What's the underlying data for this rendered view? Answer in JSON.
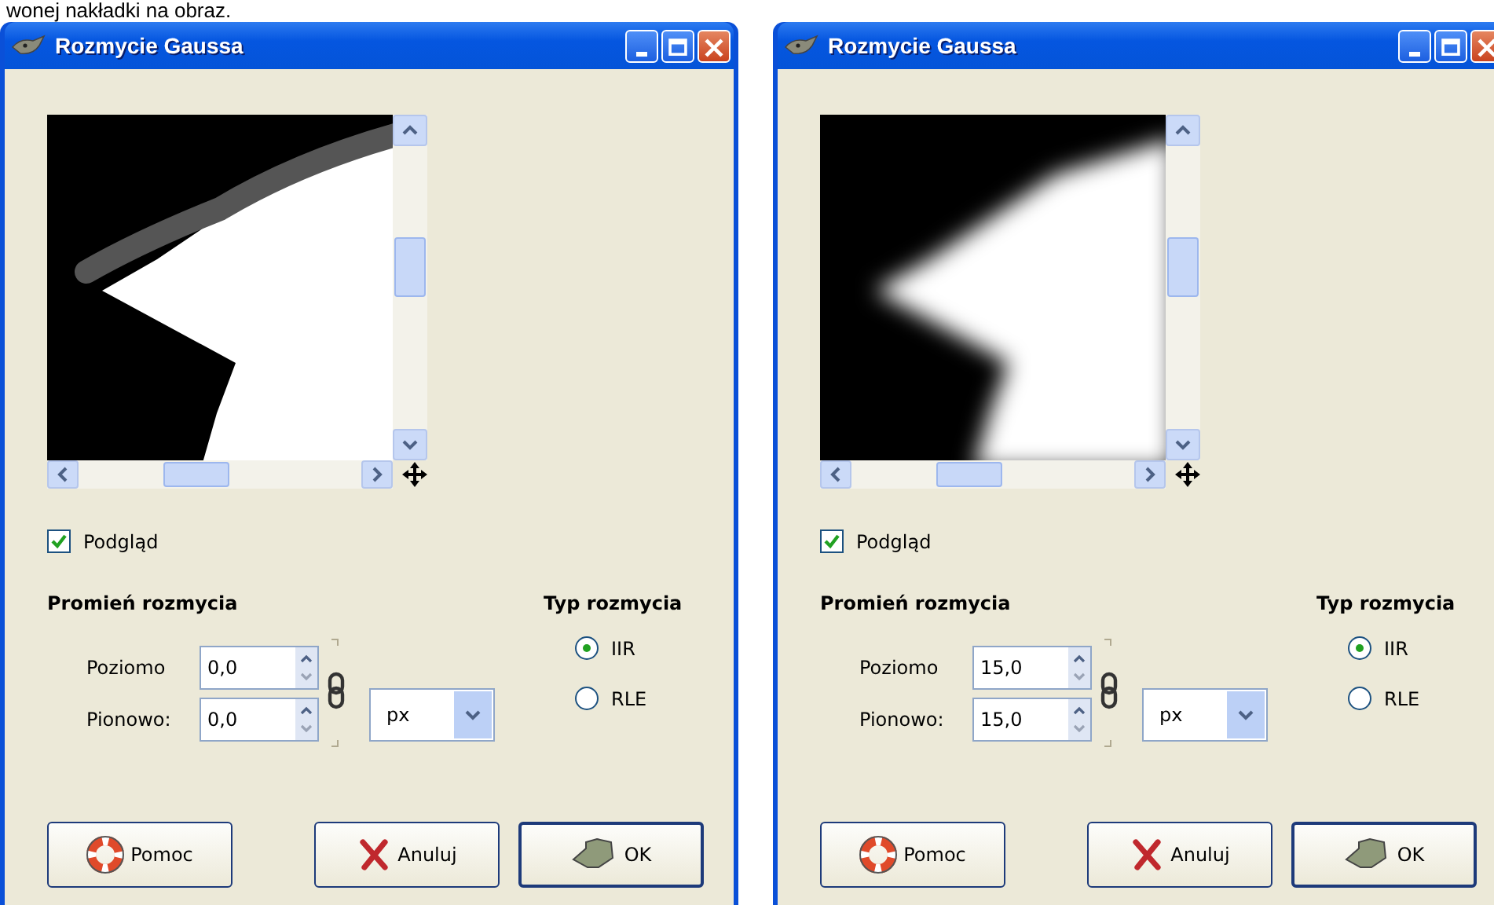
{
  "caption": "wonej nakładki na obraz.",
  "dialogs": [
    {
      "title": "Rozmycie Gaussa",
      "preview": {
        "blurred": false
      },
      "preview_toggle": {
        "label": "Podgląd",
        "checked": true
      },
      "radius": {
        "heading": "Promień rozmycia",
        "fields": [
          {
            "label": "Poziomo",
            "value": "0,0"
          },
          {
            "label": "Pionowo:",
            "value": "0,0"
          }
        ],
        "unit": "px"
      },
      "blur_type": {
        "heading": "Typ rozmycia",
        "options": [
          {
            "label": "IIR",
            "selected": true
          },
          {
            "label": "RLE",
            "selected": false
          }
        ]
      },
      "buttons": [
        {
          "kind": "help",
          "label": "Pomoc"
        },
        {
          "kind": "cancel",
          "label": "Anuluj"
        },
        {
          "kind": "ok",
          "label": "OK"
        }
      ]
    },
    {
      "title": "Rozmycie Gaussa",
      "preview": {
        "blurred": true
      },
      "preview_toggle": {
        "label": "Podgląd",
        "checked": true
      },
      "radius": {
        "heading": "Promień rozmycia",
        "fields": [
          {
            "label": "Poziomo",
            "value": "15,0"
          },
          {
            "label": "Pionowo:",
            "value": "15,0"
          }
        ],
        "unit": "px"
      },
      "blur_type": {
        "heading": "Typ rozmycia",
        "options": [
          {
            "label": "IIR",
            "selected": true
          },
          {
            "label": "RLE",
            "selected": false
          }
        ]
      },
      "buttons": [
        {
          "kind": "help",
          "label": "Pomoc"
        },
        {
          "kind": "cancel",
          "label": "Anuluj"
        },
        {
          "kind": "ok",
          "label": "OK"
        }
      ]
    }
  ]
}
